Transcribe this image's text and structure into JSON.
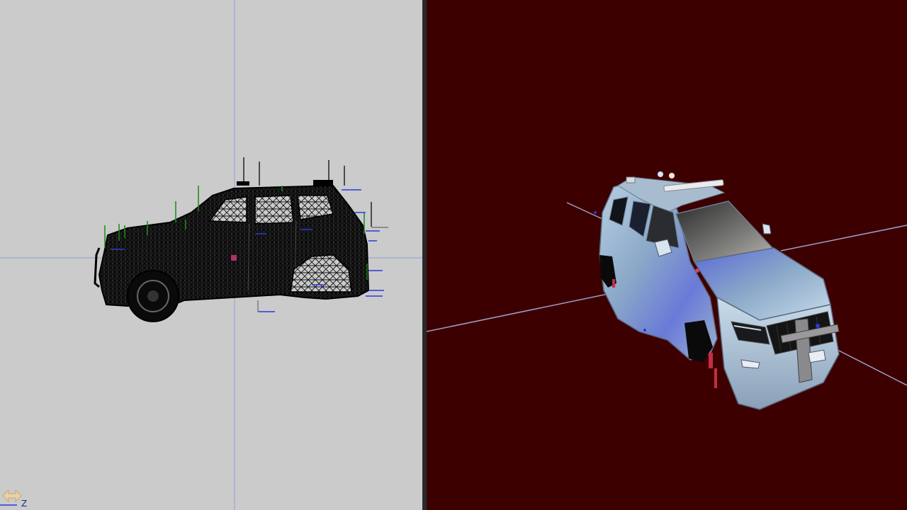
{
  "viewports": {
    "left": {
      "mode": "wireframe",
      "view": "side",
      "background": "#cbcbcb"
    },
    "right": {
      "mode": "shaded",
      "view": "perspective",
      "background": "#3d0000"
    }
  },
  "axis_indicator": {
    "label": "Z",
    "icon": "pan-arrows-icon"
  },
  "colors": {
    "wire": "#0a0a0a",
    "grid_axis": "#8fa0d8",
    "normal_green": "#1a8a1a",
    "normal_blue": "#2a3ad8",
    "car_body": "#8aa8c8",
    "car_highlight": "#c8dceb",
    "car_blue_tint": "#5a6ad8"
  }
}
